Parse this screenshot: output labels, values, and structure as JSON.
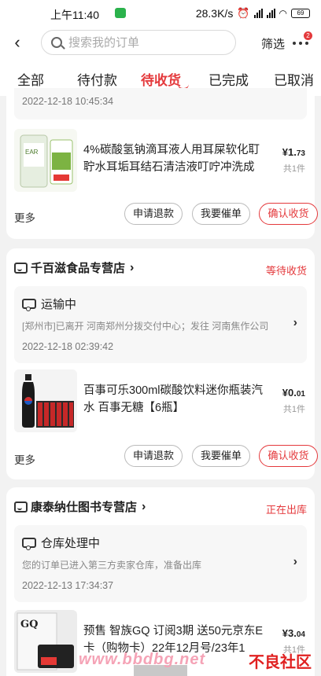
{
  "status_bar": {
    "time": "上午11:40",
    "network_speed": "28.3K/s",
    "battery": "69"
  },
  "header": {
    "back_icon": "chevron-left-icon",
    "search_placeholder": "搜索我的订单",
    "filter_label": "筛选",
    "more_badge": "2"
  },
  "tabs": [
    {
      "label": "全部"
    },
    {
      "label": "待付款"
    },
    {
      "label": "待收货",
      "active": true
    },
    {
      "label": "已完成"
    },
    {
      "label": "已取消"
    }
  ],
  "orders": [
    {
      "log_time": "2022-12-18 10:45:34",
      "product_name": "4%碳酸氢钠滴耳液人用耳屎软化耵聍水耳垢耳结石清洁液叮咛冲洗成人...",
      "price_int": "¥1.",
      "price_dec": "73",
      "qty": "共1件",
      "more_label": "更多",
      "btn_refund": "申请退款",
      "btn_urge": "我要催单",
      "btn_confirm": "确认收货"
    },
    {
      "shop_name": "千百滋食品专营店",
      "status": "等待收货",
      "log_title": "运输中",
      "log_detail": "[郑州市]已离开 河南郑州分拨交付中心；发往 河南焦作公司",
      "log_time": "2022-12-18 02:39:42",
      "product_name": "百事可乐300ml碳酸饮料迷你瓶装汽水 百事无糖【6瓶】",
      "price_int": "¥0.",
      "price_dec": "01",
      "qty": "共1件",
      "more_label": "更多",
      "btn_refund": "申请退款",
      "btn_urge": "我要催单",
      "btn_confirm": "确认收货"
    },
    {
      "shop_name": "康泰纳仕图书专营店",
      "status": "正在出库",
      "log_title": "仓库处理中",
      "log_detail": "您的订单已进入第三方卖家仓库，准备出库",
      "log_time": "2022-12-13 17:34:37",
      "product_name": "预售 智族GQ 订阅3期 送50元京东E卡（购物卡）22年12月号/23年1",
      "price_int": "¥3.",
      "price_dec": "04",
      "qty": "共1件"
    }
  ],
  "watermark": {
    "text": "www.bbdbg.net",
    "brand": "不良社区"
  },
  "colors": {
    "accent": "#e4393c",
    "background": "#f2f2f2"
  }
}
